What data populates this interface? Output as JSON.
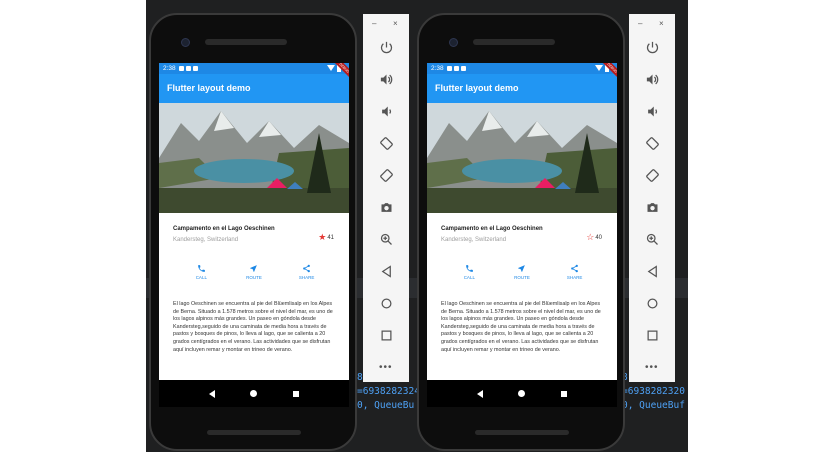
{
  "app": {
    "status_time": "2:38",
    "appbar_title": "Flutter layout demo",
    "debug_banner": "DEBUG"
  },
  "place": {
    "title": "Campamento en el Lago Oeschinen",
    "location": "Kandersteg, Switzerland",
    "description": "El lago Oeschinen se encuentra al pie del Blüemlisalp en los Alpes de Berna. Situado a 1.578 metros sobre el nivel del mar, es uno de los lagos alpinos más grandes. Un paseo en góndola desde Kandersteg,seguido de una caminata de media hora a través de pastos y bosques de pinos, lo lleva al lago, que se calienta a 20 grados centígrados en el verano. Las actividades que se disfrutan aquí incluyen remar y montar en trineo de verano."
  },
  "phones": [
    {
      "favorite": true,
      "count": "41"
    },
    {
      "favorite": false,
      "count": "40"
    }
  ],
  "actions": {
    "call": "CALL",
    "route": "ROUTE",
    "share": "SHARE"
  },
  "emulator_panel": {
    "minimize": "–",
    "close": "×",
    "icons": [
      "power-icon",
      "volume-up-icon",
      "volume-down-icon",
      "rotate-left-icon",
      "rotate-right-icon",
      "camera-icon",
      "zoom-in-icon",
      "back-icon",
      "home-icon",
      "overview-icon"
    ],
    "more": "•••"
  },
  "ide": {
    "left_lines": [
      "8",
      "=6938282324",
      "0, QueueBu"
    ],
    "right_lines": [
      "8, N",
      "=6938282320",
      "0, QueueBuf"
    ]
  },
  "colors": {
    "primary": "#2196f3",
    "status": "#1e88e5",
    "star": "#e53935",
    "device_bg": "#1f2021"
  }
}
